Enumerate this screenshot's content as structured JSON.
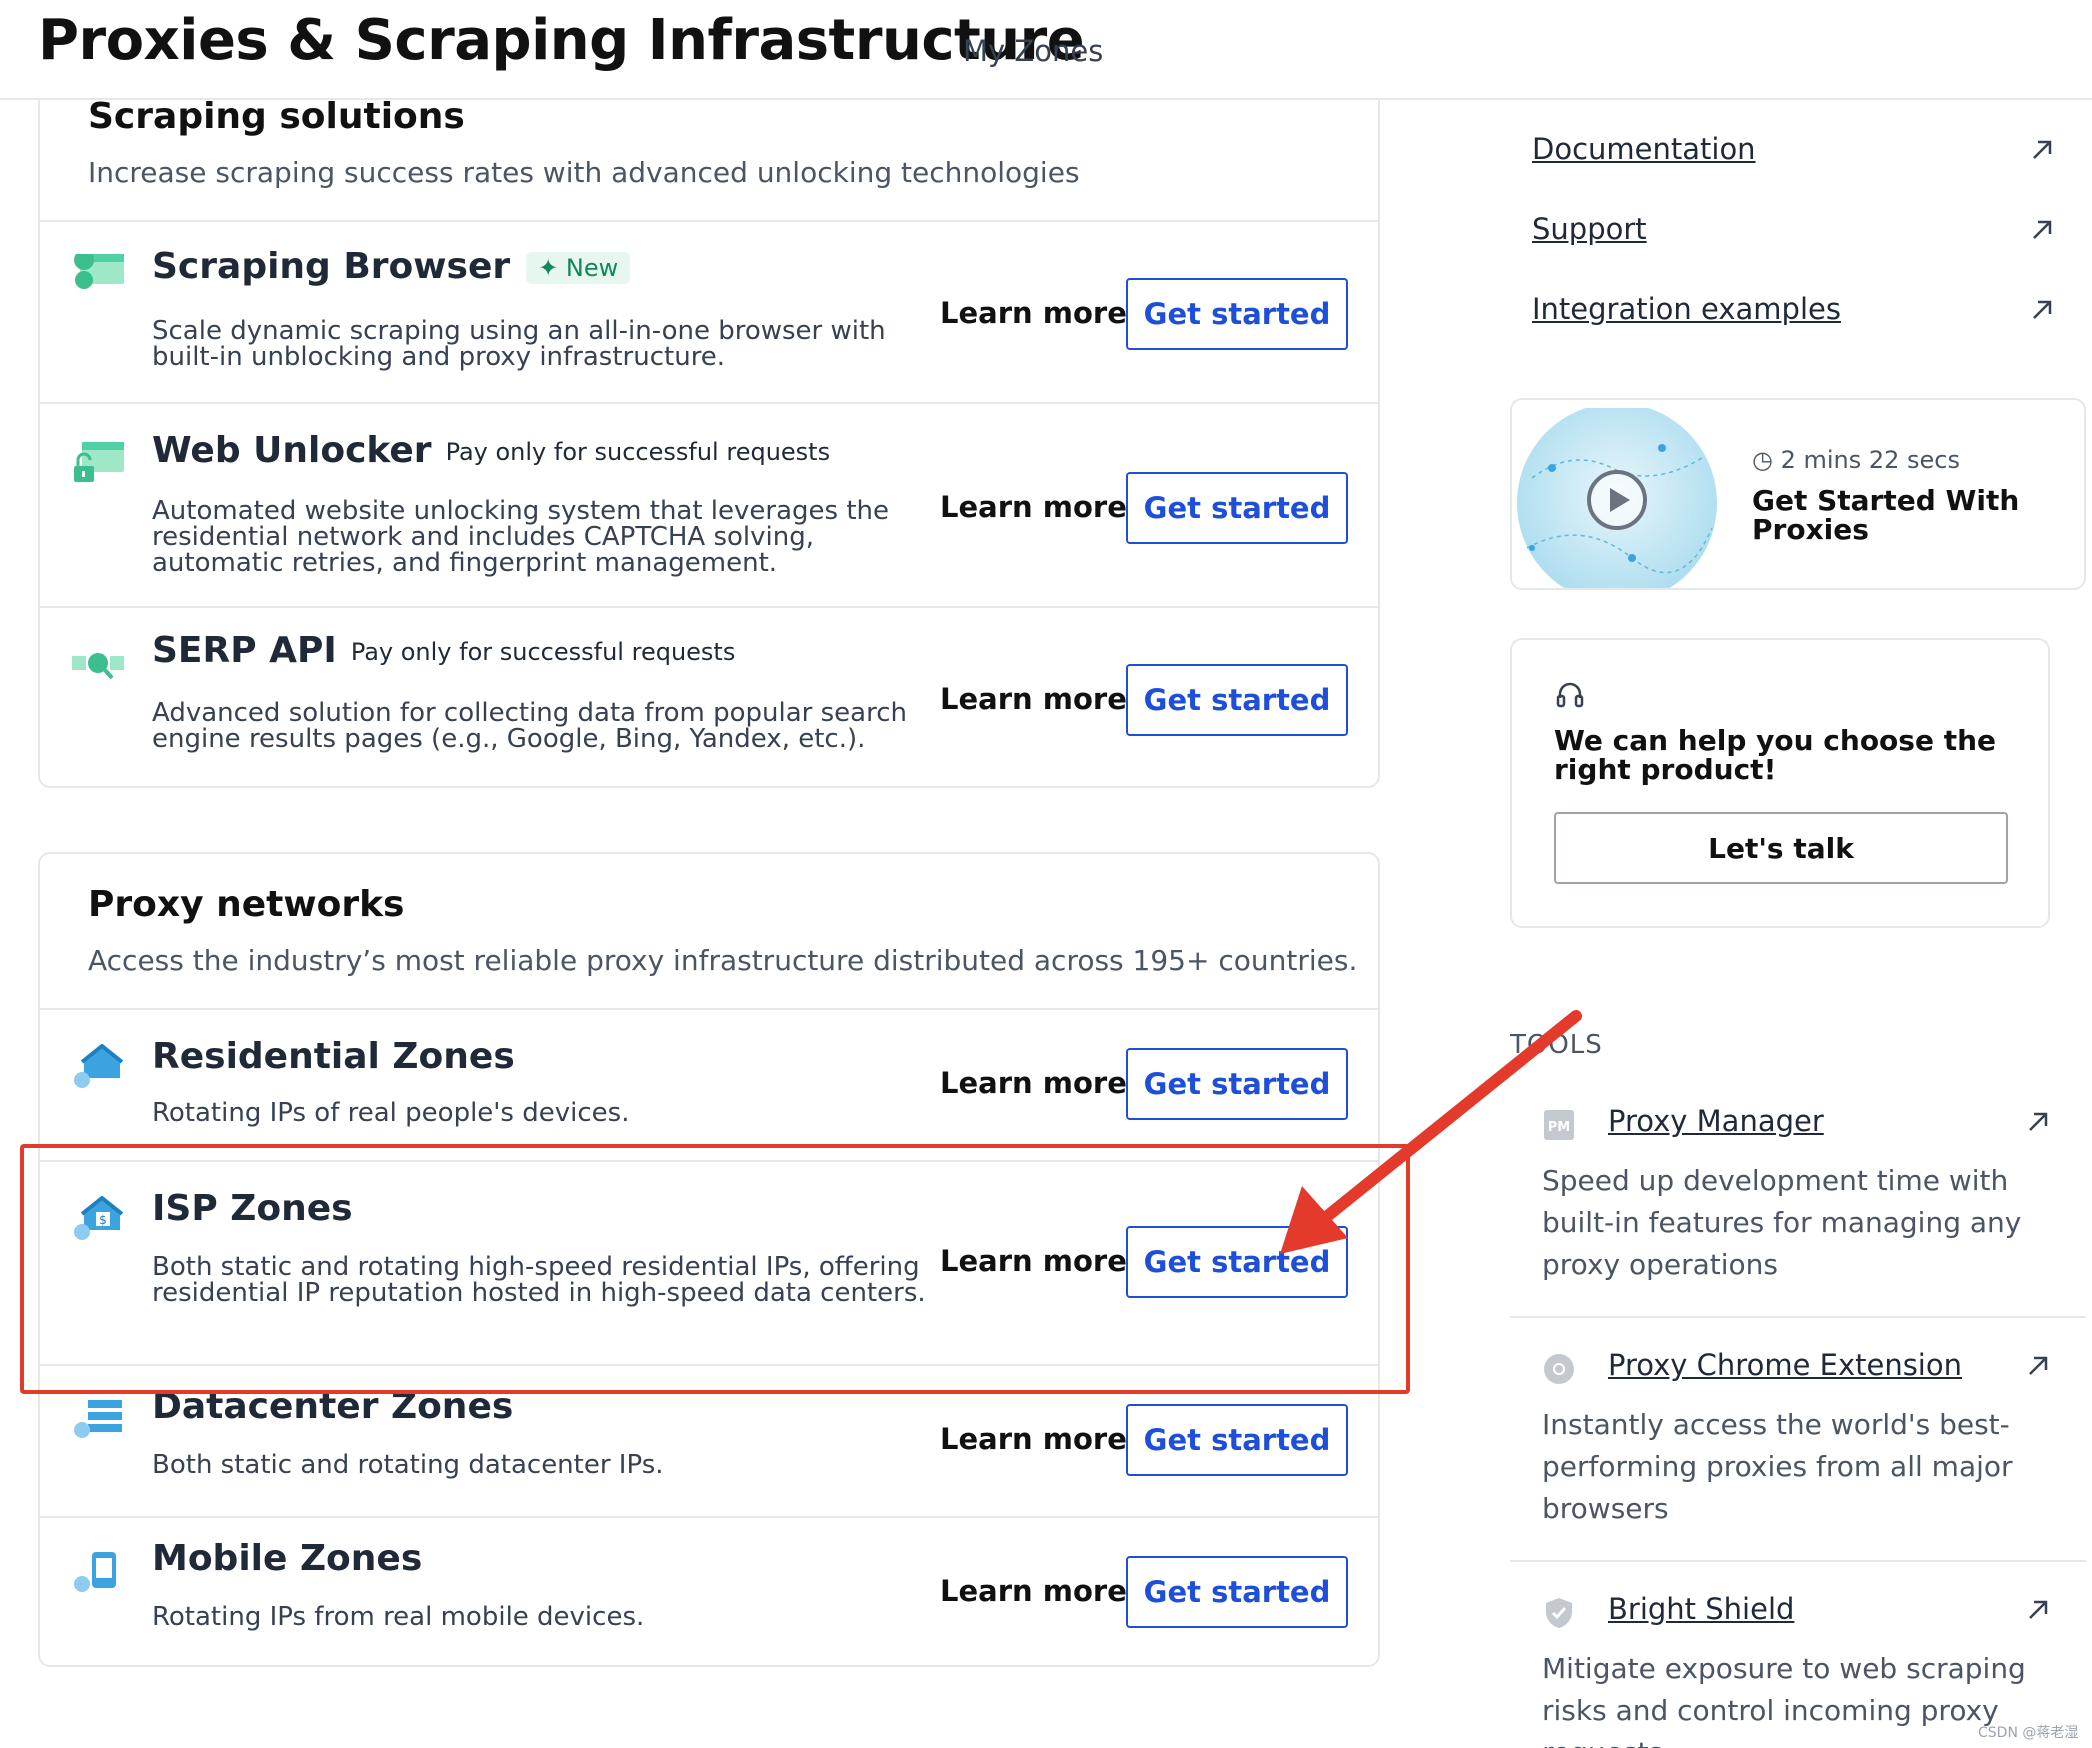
{
  "header": {
    "title": "Proxies & Scraping Infrastructure",
    "breadcrumb": "My Zones"
  },
  "scraping": {
    "title": "Scraping solutions",
    "subtitle": "Increase scraping success rates with advanced unlocking technologies",
    "products": [
      {
        "name": "Scraping Browser",
        "badge": "New",
        "icon": "browser-icon",
        "description": "Scale dynamic scraping using an all-in-one browser with built-in unblocking and proxy infrastructure."
      },
      {
        "name": "Web Unlocker",
        "tagline": "Pay only for successful requests",
        "icon": "unlock-icon",
        "description": "Automated website unlocking system that leverages the residential network and includes CAPTCHA solving, automatic retries, and fingerprint management."
      },
      {
        "name": "SERP API",
        "tagline": "Pay only for successful requests",
        "icon": "serp-search-icon",
        "description": "Advanced solution for collecting data from popular search engine results pages (e.g., Google, Bing, Yandex, etc.)."
      }
    ]
  },
  "proxy": {
    "title": "Proxy networks",
    "subtitle": "Access the industry’s most reliable proxy infrastructure distributed across 195+ countries.",
    "products": [
      {
        "name": "Residential Zones",
        "icon": "house-icon",
        "description": "Rotating IPs of real people's devices."
      },
      {
        "name": "ISP Zones",
        "icon": "isp-house-icon",
        "description": "Both static and rotating high-speed residential IPs, offering residential IP reputation hosted in high-speed data centers."
      },
      {
        "name": "Datacenter Zones",
        "icon": "server-icon",
        "description": "Both static and rotating datacenter IPs."
      },
      {
        "name": "Mobile Zones",
        "icon": "mobile-icon",
        "description": "Rotating IPs from real mobile devices."
      }
    ]
  },
  "actions": {
    "learn_more": "Learn more",
    "get_started": "Get started"
  },
  "resources": {
    "links": [
      {
        "label": "Documentation"
      },
      {
        "label": "Support"
      },
      {
        "label": "Integration examples"
      }
    ]
  },
  "video": {
    "duration": "2 mins 22 secs",
    "title": "Get Started With Proxies"
  },
  "help": {
    "text": "We can help you choose the right product!",
    "button": "Let's talk"
  },
  "tools": {
    "label": "TOOLS",
    "items": [
      {
        "name": "Proxy Manager",
        "icon": "proxy-manager-icon",
        "description": "Speed up development time with built-in features for managing any proxy operations"
      },
      {
        "name": "Proxy Chrome Extension",
        "icon": "chrome-icon",
        "description": "Instantly access the world's best-performing proxies from all major browsers"
      },
      {
        "name": "Bright Shield",
        "icon": "shield-icon",
        "description": "Mitigate exposure to web scraping risks and control incoming proxy requests"
      }
    ]
  },
  "watermark": "CSDN @蒋老湿",
  "colors": {
    "accent": "#1d4fd8",
    "annotation": "#e33a2c",
    "icon_teal": "#4fd1a5",
    "icon_blue": "#3aa3e0"
  }
}
